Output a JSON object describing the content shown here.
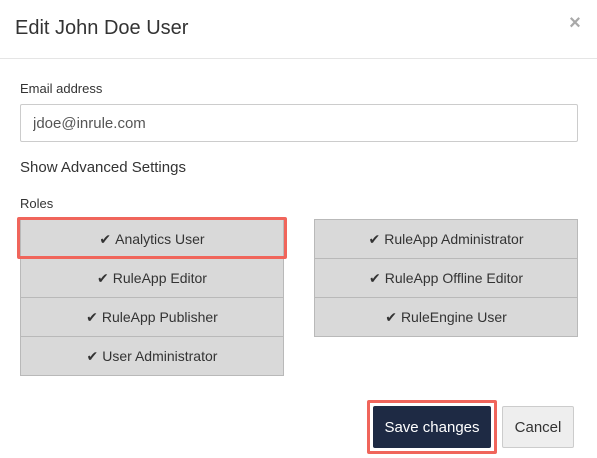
{
  "dialog": {
    "title": "Edit John Doe User",
    "close_symbol": "×"
  },
  "email": {
    "label": "Email address",
    "value": "jdoe@inrule.com"
  },
  "advanced": {
    "label": "Show Advanced Settings"
  },
  "roles": {
    "label": "Roles",
    "check_icon": "check-icon",
    "check_symbol": "✔",
    "left": [
      {
        "label": "Analytics User",
        "selected": true
      },
      {
        "label": "RuleApp Editor",
        "selected": true
      },
      {
        "label": "RuleApp Publisher",
        "selected": true
      },
      {
        "label": "User Administrator",
        "selected": true
      }
    ],
    "right": [
      {
        "label": "RuleApp Administrator",
        "selected": true
      },
      {
        "label": "RuleApp Offline Editor",
        "selected": true
      },
      {
        "label": "RuleEngine User",
        "selected": true
      }
    ]
  },
  "footer": {
    "save_label": "Save changes",
    "cancel_label": "Cancel"
  },
  "colors": {
    "primary": "#1e2a44",
    "highlight": "#f0655b",
    "role_bg": "#d9d9d9"
  }
}
